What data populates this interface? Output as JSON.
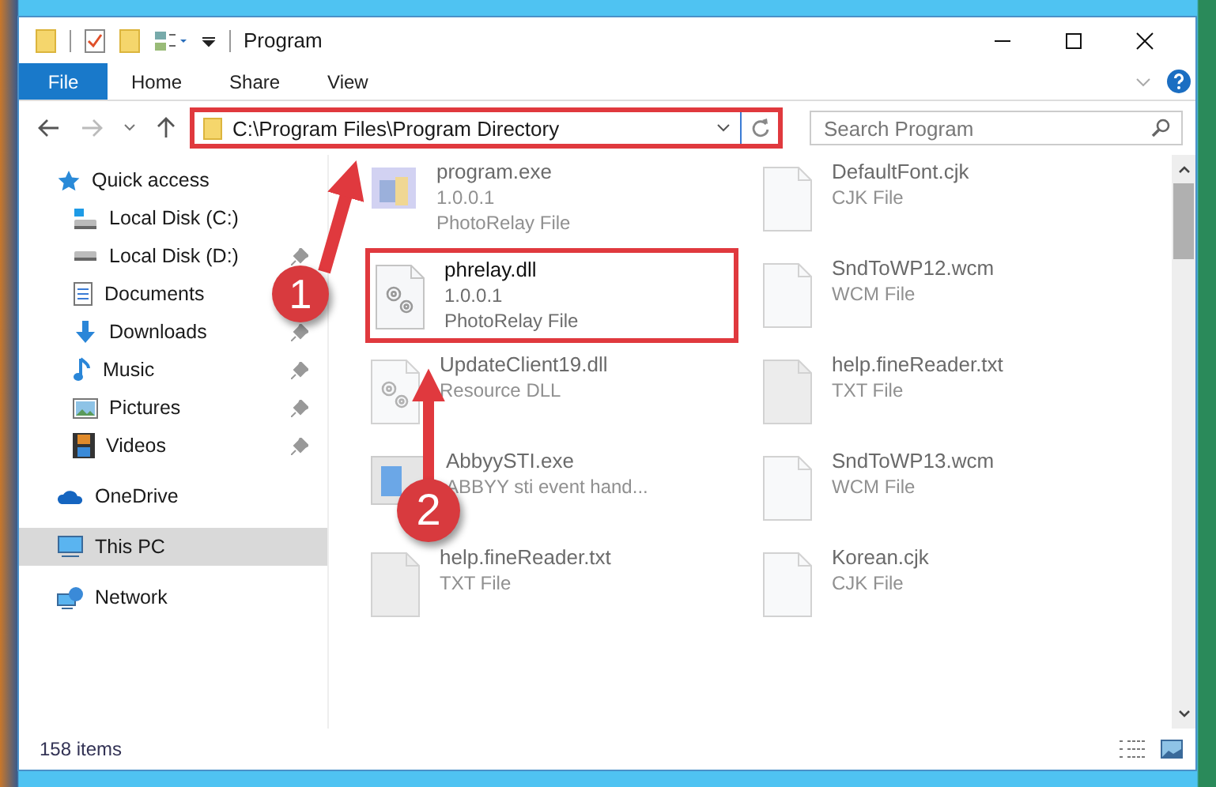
{
  "window": {
    "title": "Program"
  },
  "ribbon_tabs": [
    {
      "label": "File",
      "selected": true
    },
    {
      "label": "Home",
      "selected": false
    },
    {
      "label": "Share",
      "selected": false
    },
    {
      "label": "View",
      "selected": false
    }
  ],
  "address": {
    "path": "C:\\Program Files\\Program Directory",
    "highlighted": true
  },
  "search": {
    "placeholder": "Search Program"
  },
  "sidebar": {
    "items": [
      {
        "label": "Quick access",
        "selected": false,
        "children": [
          {
            "label": "Local Disk (C:)",
            "pinned": false
          },
          {
            "label": "Local Disk (D:)",
            "pinned": true
          },
          {
            "label": "Documents",
            "pinned": false
          },
          {
            "label": "Downloads",
            "pinned": true
          },
          {
            "label": "Music",
            "pinned": true
          },
          {
            "label": "Pictures",
            "pinned": true
          },
          {
            "label": "Videos",
            "pinned": true
          }
        ]
      },
      {
        "label": "OneDrive",
        "selected": false
      },
      {
        "label": "This PC",
        "selected": true
      },
      {
        "label": "Network",
        "selected": false
      }
    ]
  },
  "files": [
    {
      "name": "program.exe",
      "lines": [
        "1.0.0.1",
        "PhotoRelay File"
      ],
      "kind": "exe",
      "blurred": true,
      "highlighted": false
    },
    {
      "name": "DefaultFont.cjk",
      "lines": [
        "CJK File"
      ],
      "kind": "file",
      "blurred": true,
      "highlighted": false
    },
    {
      "name": "phrelay.dll",
      "lines": [
        "1.0.0.1",
        "PhotoRelay File"
      ],
      "kind": "dll",
      "blurred": false,
      "highlighted": true
    },
    {
      "name": "SndToWP12.wcm",
      "lines": [
        "WCM File"
      ],
      "kind": "file",
      "blurred": true,
      "highlighted": false
    },
    {
      "name": "UpdateClient19.dll",
      "lines": [
        "Resource DLL"
      ],
      "kind": "dll",
      "blurred": true,
      "highlighted": false
    },
    {
      "name": "help.fineReader.txt",
      "lines": [
        "TXT File"
      ],
      "kind": "text",
      "blurred": true,
      "highlighted": false
    },
    {
      "name": "AbbyySTI.exe",
      "lines": [
        "ABBYY sti event hand..."
      ],
      "kind": "app",
      "blurred": true,
      "highlighted": false
    },
    {
      "name": "SndToWP13.wcm",
      "lines": [
        "WCM File"
      ],
      "kind": "file",
      "blurred": true,
      "highlighted": false
    },
    {
      "name": "help.fineReader.txt",
      "lines": [
        "TXT File"
      ],
      "kind": "text",
      "blurred": true,
      "highlighted": false
    },
    {
      "name": "Korean.cjk",
      "lines": [
        "CJK File"
      ],
      "kind": "file",
      "blurred": true,
      "highlighted": false
    }
  ],
  "status_bar": {
    "item_count": "158 items"
  },
  "annotations": [
    {
      "number": "1"
    },
    {
      "number": "2"
    }
  ]
}
